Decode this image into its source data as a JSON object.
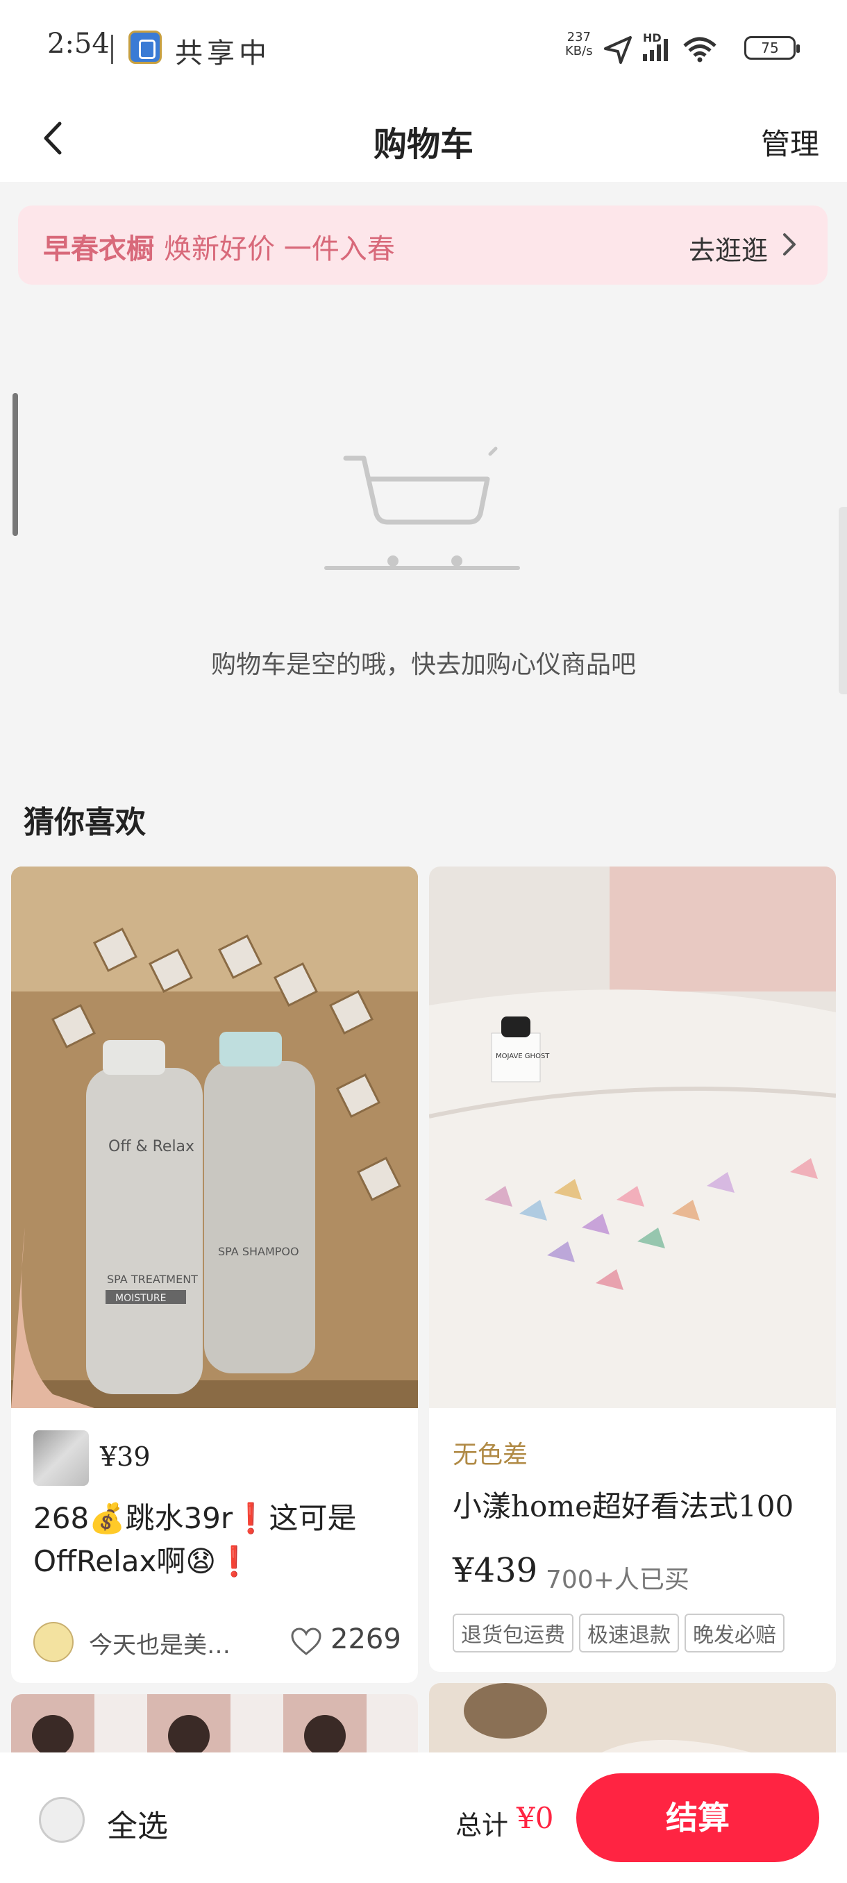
{
  "status_bar": {
    "time": "2:54",
    "sharing_text": "共享中",
    "net_speed_value": "237",
    "net_speed_unit": "KB/s",
    "hd_label": "HD",
    "battery": "75"
  },
  "nav": {
    "title": "购物车",
    "manage_label": "管理"
  },
  "banner": {
    "title": "早春衣橱",
    "subtitle": "焕新好价 一件入春",
    "action": "去逛逛"
  },
  "empty_state": {
    "message": "购物车是空的哦，快去加购心仪商品吧"
  },
  "recommend": {
    "heading": "猜你喜欢",
    "cards": [
      {
        "price": "¥39",
        "title": "268💰跳水39r❗这可是OffRelax啊😧❗",
        "author": "今天也是美…",
        "likes": "2269",
        "image_text_1": "Off & Relax",
        "image_text_2": "SPA TREATMENT",
        "image_text_3": "MOISTURE",
        "image_text_4": "SPA SHAMPOO"
      },
      {
        "tag": "无色差",
        "title": "小漾home超好看法式100",
        "price": "¥439",
        "sold": "700+人已买",
        "badges": [
          "退货包运费",
          "极速退款",
          "晚发必赔"
        ],
        "image_text_1": "MOJAVE GHOST"
      }
    ]
  },
  "bottom_bar": {
    "select_all": "全选",
    "total_label": "总计",
    "total_value": "¥0",
    "checkout_label": "结算"
  },
  "colors": {
    "accent": "#ff2442",
    "banner_bg": "#fde6ea",
    "banner_text": "#d8697a",
    "tag_gold": "#b08a45"
  }
}
